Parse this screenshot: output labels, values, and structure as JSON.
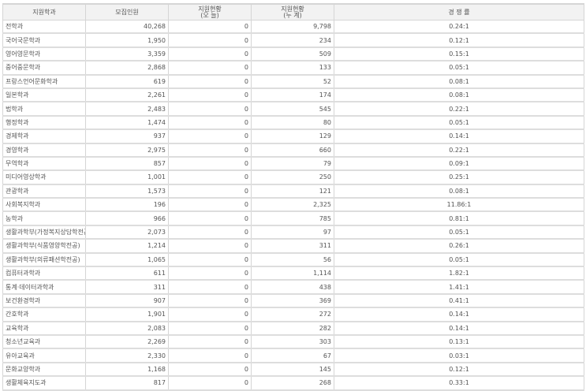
{
  "headers": {
    "dept": "지원학과",
    "quota": "모집인원",
    "today_l1": "지원현황",
    "today_l2": "(오    늘)",
    "total_l1": "지원현황",
    "total_l2": "(누    계)",
    "ratio": "경 쟁 률"
  },
  "rows": [
    {
      "dept": "전학과",
      "quota": "40,268",
      "today": "0",
      "total": "9,798",
      "ratio": "0.24:1"
    },
    {
      "dept": "국어국문학과",
      "quota": "1,950",
      "today": "0",
      "total": "234",
      "ratio": "0.12:1"
    },
    {
      "dept": "영어영문학과",
      "quota": "3,359",
      "today": "0",
      "total": "509",
      "ratio": "0.15:1"
    },
    {
      "dept": "중어중문학과",
      "quota": "2,868",
      "today": "0",
      "total": "133",
      "ratio": "0.05:1"
    },
    {
      "dept": "프랑스언어문화학과",
      "quota": "619",
      "today": "0",
      "total": "52",
      "ratio": "0.08:1"
    },
    {
      "dept": "일본학과",
      "quota": "2,261",
      "today": "0",
      "total": "174",
      "ratio": "0.08:1"
    },
    {
      "dept": "법학과",
      "quota": "2,483",
      "today": "0",
      "total": "545",
      "ratio": "0.22:1"
    },
    {
      "dept": "행정학과",
      "quota": "1,474",
      "today": "0",
      "total": "80",
      "ratio": "0.05:1"
    },
    {
      "dept": "경제학과",
      "quota": "937",
      "today": "0",
      "total": "129",
      "ratio": "0.14:1"
    },
    {
      "dept": "경영학과",
      "quota": "2,975",
      "today": "0",
      "total": "660",
      "ratio": "0.22:1"
    },
    {
      "dept": "무역학과",
      "quota": "857",
      "today": "0",
      "total": "79",
      "ratio": "0.09:1"
    },
    {
      "dept": "미디어영상학과",
      "quota": "1,001",
      "today": "0",
      "total": "250",
      "ratio": "0.25:1"
    },
    {
      "dept": "관광학과",
      "quota": "1,573",
      "today": "0",
      "total": "121",
      "ratio": "0.08:1"
    },
    {
      "dept": "사회복지학과",
      "quota": "196",
      "today": "0",
      "total": "2,325",
      "ratio": "11.86:1"
    },
    {
      "dept": "농학과",
      "quota": "966",
      "today": "0",
      "total": "785",
      "ratio": "0.81:1"
    },
    {
      "dept": "생활과학부(가정복지상담학전공)",
      "quota": "2,073",
      "today": "0",
      "total": "97",
      "ratio": "0.05:1"
    },
    {
      "dept": "생활과학부(식품영양학전공)",
      "quota": "1,214",
      "today": "0",
      "total": "311",
      "ratio": "0.26:1"
    },
    {
      "dept": "생활과학부(의류패션학전공)",
      "quota": "1,065",
      "today": "0",
      "total": "56",
      "ratio": "0.05:1"
    },
    {
      "dept": "컴퓨터과학과",
      "quota": "611",
      "today": "0",
      "total": "1,114",
      "ratio": "1.82:1"
    },
    {
      "dept": "통계·데이터과학과",
      "quota": "311",
      "today": "0",
      "total": "438",
      "ratio": "1.41:1"
    },
    {
      "dept": "보건환경학과",
      "quota": "907",
      "today": "0",
      "total": "369",
      "ratio": "0.41:1"
    },
    {
      "dept": "간호학과",
      "quota": "1,901",
      "today": "0",
      "total": "272",
      "ratio": "0.14:1"
    },
    {
      "dept": "교육학과",
      "quota": "2,083",
      "today": "0",
      "total": "282",
      "ratio": "0.14:1"
    },
    {
      "dept": "청소년교육과",
      "quota": "2,269",
      "today": "0",
      "total": "303",
      "ratio": "0.13:1"
    },
    {
      "dept": "유아교육과",
      "quota": "2,330",
      "today": "0",
      "total": "67",
      "ratio": "0.03:1"
    },
    {
      "dept": "문화교양학과",
      "quota": "1,168",
      "today": "0",
      "total": "145",
      "ratio": "0.12:1"
    },
    {
      "dept": "생활체육지도과",
      "quota": "817",
      "today": "0",
      "total": "268",
      "ratio": "0.33:1"
    }
  ]
}
